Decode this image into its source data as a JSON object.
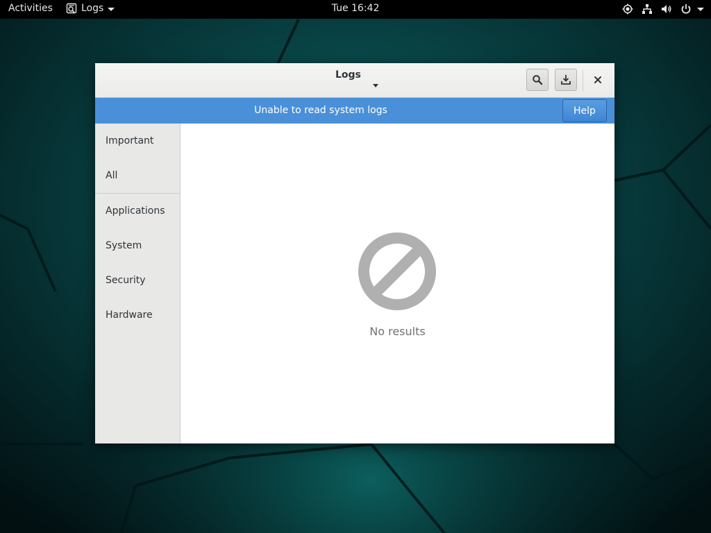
{
  "topbar": {
    "activities": "Activities",
    "app_name": "Logs",
    "clock": "Tue 16:42",
    "status_icons": [
      "location-icon",
      "network-icon",
      "volume-icon",
      "power-icon"
    ]
  },
  "window": {
    "title": "Logs",
    "buttons": [
      "search-icon",
      "export-icon",
      "close-icon"
    ]
  },
  "infobar": {
    "message": "Unable to read system logs",
    "help_label": "Help",
    "color": "#4a90d9"
  },
  "sidebar": {
    "items": [
      {
        "label": "Important"
      },
      {
        "label": "All"
      },
      {
        "label": "Applications"
      },
      {
        "label": "System"
      },
      {
        "label": "Security"
      },
      {
        "label": "Hardware"
      }
    ]
  },
  "content": {
    "empty_label": "No results",
    "empty_icon": "no-results-icon"
  }
}
